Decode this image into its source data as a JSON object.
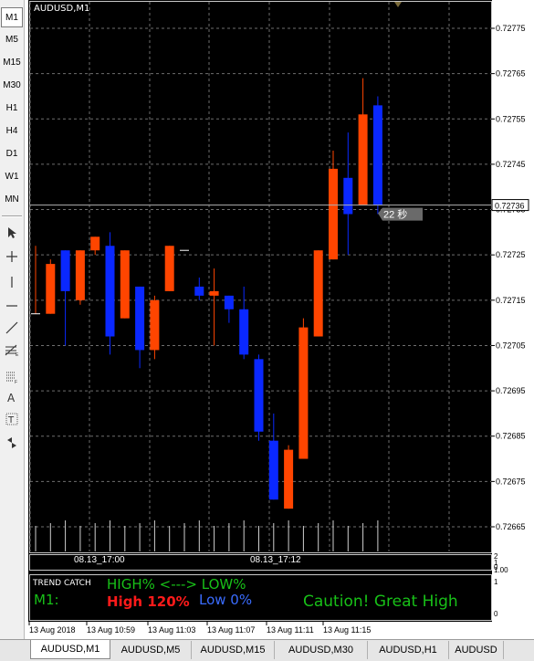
{
  "toolbar": {
    "timeframes": [
      "M1",
      "M5",
      "M15",
      "M30",
      "H1",
      "H4",
      "D1",
      "W1",
      "MN"
    ],
    "active_timeframe": "M1",
    "tools": [
      "cursor-icon",
      "crosshair-icon",
      "vertical-line-icon",
      "horizontal-line-icon",
      "trendline-icon",
      "fibonacci-icon",
      "channel-icon",
      "text-icon",
      "text-label-icon",
      "arrows-icon"
    ],
    "tool_labels": {
      "text": "A",
      "text_label": "T"
    }
  },
  "chart": {
    "symbol_title": "AUDUSD,M1",
    "background": "#000000",
    "bull_color": "#ff4500",
    "bear_color": "#0a28ff",
    "grid_color": "#6e6e6e",
    "price_axis": [
      "0.72775",
      "0.72765",
      "0.72755",
      "0.72745",
      "0.72735",
      "0.72725",
      "0.72715",
      "0.72705",
      "0.72695",
      "0.72685",
      "0.72675",
      "0.72665"
    ],
    "current_price": "0.72736",
    "countdown": "22 秒",
    "volume_axis": [
      "2",
      "1",
      "0"
    ],
    "indicator_axis": [
      "1",
      "0"
    ],
    "indicator_scale_top": "1.00",
    "time_markers": [
      "08.13_17:00",
      "08.13_17:12"
    ],
    "time_axis": [
      "13 Aug 2018",
      "13 Aug 10:59",
      "13 Aug 11:03",
      "13 Aug 11:07",
      "13 Aug 11:11",
      "13 Aug 11:15"
    ]
  },
  "chart_data": {
    "type": "candlestick",
    "title": "AUDUSD,M1",
    "ylim": [
      0.72662,
      0.72785
    ],
    "candles": [
      {
        "o": 0.72712,
        "h": 0.72727,
        "l": 0.72712,
        "c": 0.72712
      },
      {
        "o": 0.72712,
        "h": 0.72724,
        "l": 0.72712,
        "c": 0.72723
      },
      {
        "o": 0.72726,
        "h": 0.72726,
        "l": 0.72705,
        "c": 0.72717
      },
      {
        "o": 0.72715,
        "h": 0.72726,
        "l": 0.72714,
        "c": 0.72726
      },
      {
        "o": 0.72726,
        "h": 0.72729,
        "l": 0.72725,
        "c": 0.72729
      },
      {
        "o": 0.72727,
        "h": 0.7273,
        "l": 0.72703,
        "c": 0.72707
      },
      {
        "o": 0.72711,
        "h": 0.72726,
        "l": 0.72711,
        "c": 0.72726
      },
      {
        "o": 0.72718,
        "h": 0.72718,
        "l": 0.727,
        "c": 0.72704
      },
      {
        "o": 0.72704,
        "h": 0.72716,
        "l": 0.72702,
        "c": 0.72715
      },
      {
        "o": 0.72717,
        "h": 0.72727,
        "l": 0.72717,
        "c": 0.72727
      },
      {
        "o": 0.72726,
        "h": 0.72726,
        "l": 0.72726,
        "c": 0.72726
      },
      {
        "o": 0.72718,
        "h": 0.7272,
        "l": 0.72715,
        "c": 0.72716
      },
      {
        "o": 0.72716,
        "h": 0.72722,
        "l": 0.72705,
        "c": 0.72717
      },
      {
        "o": 0.72716,
        "h": 0.72716,
        "l": 0.7271,
        "c": 0.72713
      },
      {
        "o": 0.72713,
        "h": 0.72718,
        "l": 0.72702,
        "c": 0.72703
      },
      {
        "o": 0.72702,
        "h": 0.72703,
        "l": 0.72684,
        "c": 0.72686
      },
      {
        "o": 0.72684,
        "h": 0.7269,
        "l": 0.72671,
        "c": 0.72671
      },
      {
        "o": 0.72669,
        "h": 0.72683,
        "l": 0.72669,
        "c": 0.72682
      },
      {
        "o": 0.7268,
        "h": 0.72711,
        "l": 0.7268,
        "c": 0.72709
      },
      {
        "o": 0.72707,
        "h": 0.72726,
        "l": 0.72707,
        "c": 0.72726
      },
      {
        "o": 0.72724,
        "h": 0.72748,
        "l": 0.72724,
        "c": 0.72744
      },
      {
        "o": 0.72742,
        "h": 0.72752,
        "l": 0.72725,
        "c": 0.72734
      },
      {
        "o": 0.72736,
        "h": 0.72764,
        "l": 0.72736,
        "c": 0.72756
      },
      {
        "o": 0.72758,
        "h": 0.7276,
        "l": 0.72734,
        "c": 0.72736
      }
    ],
    "volumes": [
      1,
      1,
      1,
      1,
      1,
      1,
      1,
      1,
      1,
      1,
      1,
      1,
      1,
      1,
      1,
      1,
      1,
      1,
      1,
      1,
      1,
      1,
      1,
      1
    ],
    "current_price": 0.72736
  },
  "indicator": {
    "name": "TREND CATCH",
    "header": "HIGH% <---> LOW%",
    "timeframe_label": "M1:",
    "high_text": "High 120%",
    "low_text": "Low 0%",
    "message": "Caution! Great High",
    "colors": {
      "green": "#18c018",
      "red": "#ff1a1a",
      "blue": "#3a6cff"
    }
  },
  "tabs": [
    "AUDUSD,M1",
    "AUDUSD,M5",
    "AUDUSD,M15",
    "AUDUSD,M30",
    "AUDUSD,H1",
    "AUDUSD"
  ],
  "active_tab": "AUDUSD,M1"
}
